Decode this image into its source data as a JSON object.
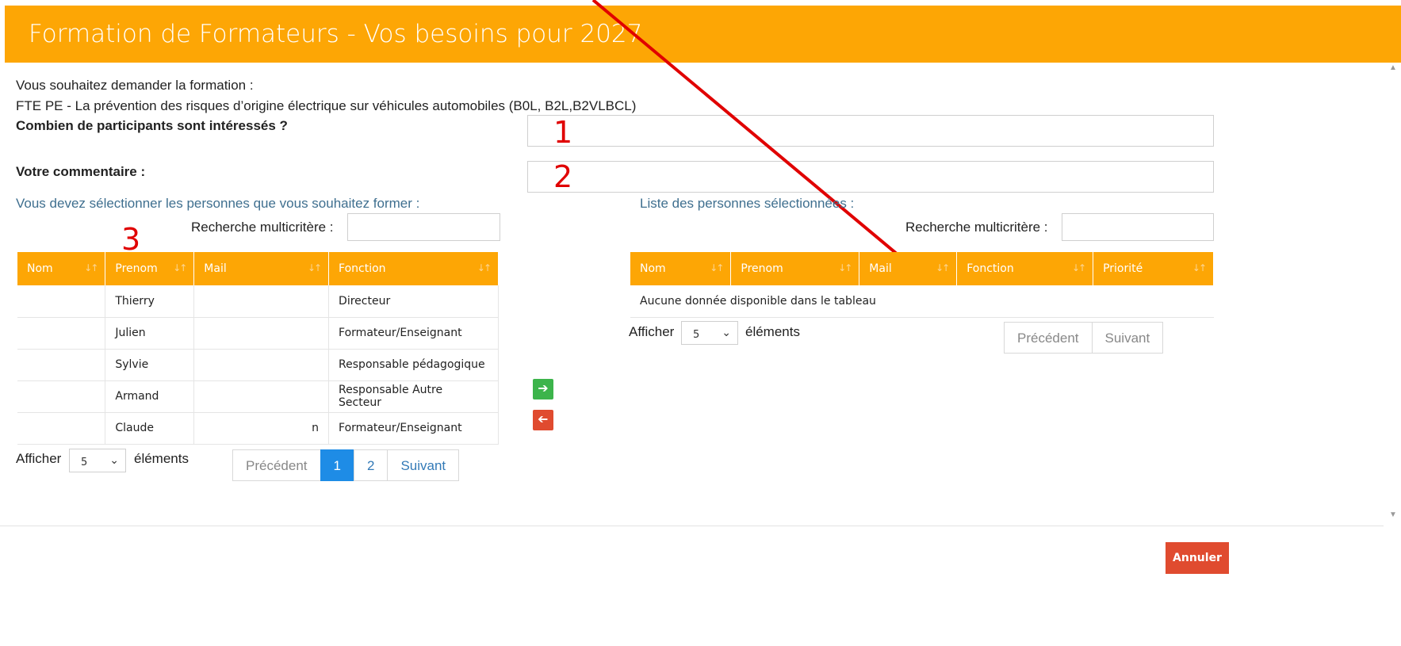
{
  "header": {
    "title": "Formation de Formateurs - Vos besoins pour 2027"
  },
  "intro": {
    "line1": "Vous souhaitez demander la formation :",
    "line2": "FTE PE - La prévention des risques d’origine électrique sur véhicules automobiles (B0L, B2L,B2VLBCL)"
  },
  "form": {
    "participants_label": "Combien de participants sont intéressés ?",
    "participants_value": "",
    "comment_label": "Votre commentaire :",
    "comment_value": ""
  },
  "annotations": {
    "n1": "1",
    "n2": "2",
    "n3": "3",
    "arrow_color": "#e00000"
  },
  "left_panel": {
    "title": "Vous devez sélectionner les personnes que vous souhaitez former :",
    "search_label": "Recherche multicritère :",
    "search_value": "",
    "columns": [
      "Nom",
      "Prenom",
      "Mail",
      "Fonction"
    ],
    "rows": [
      {
        "nom": "",
        "prenom": "Thierry",
        "mail": "",
        "fonction": "Directeur"
      },
      {
        "nom": "",
        "prenom": "Julien",
        "mail": "",
        "fonction": "Formateur/Enseignant"
      },
      {
        "nom": "",
        "prenom": "Sylvie",
        "mail": "",
        "fonction": "Responsable pédagogique"
      },
      {
        "nom": "",
        "prenom": "Armand",
        "mail": "",
        "fonction": "Responsable Autre Secteur"
      },
      {
        "nom": "",
        "prenom": "Claude",
        "mail": "n",
        "fonction": "Formateur/Enseignant"
      }
    ],
    "show_label": "Afficher",
    "show_value": "5",
    "elements_label": "éléments",
    "pagination": {
      "prev": "Précédent",
      "pages": [
        "1",
        "2"
      ],
      "active_page": "1",
      "next": "Suivant"
    }
  },
  "transfer": {
    "add_icon": "arrow-right-icon",
    "remove_icon": "arrow-left-icon",
    "add_color": "#3cb44b",
    "remove_color": "#e04b2f"
  },
  "right_panel": {
    "title": "Liste des personnes sélectionnées :",
    "search_label": "Recherche multicritère :",
    "search_value": "",
    "columns": [
      "Nom",
      "Prenom",
      "Mail",
      "Fonction",
      "Priorité"
    ],
    "empty_message": "Aucune donnée disponible dans le tableau",
    "show_label": "Afficher",
    "show_value": "5",
    "elements_label": "éléments",
    "pagination": {
      "prev": "Précédent",
      "next": "Suivant"
    }
  },
  "footer": {
    "cancel_label": "Annuler"
  },
  "colors": {
    "header": "#fda605",
    "accent_blue": "#1e8ce6",
    "cancel": "#e04b2f"
  }
}
